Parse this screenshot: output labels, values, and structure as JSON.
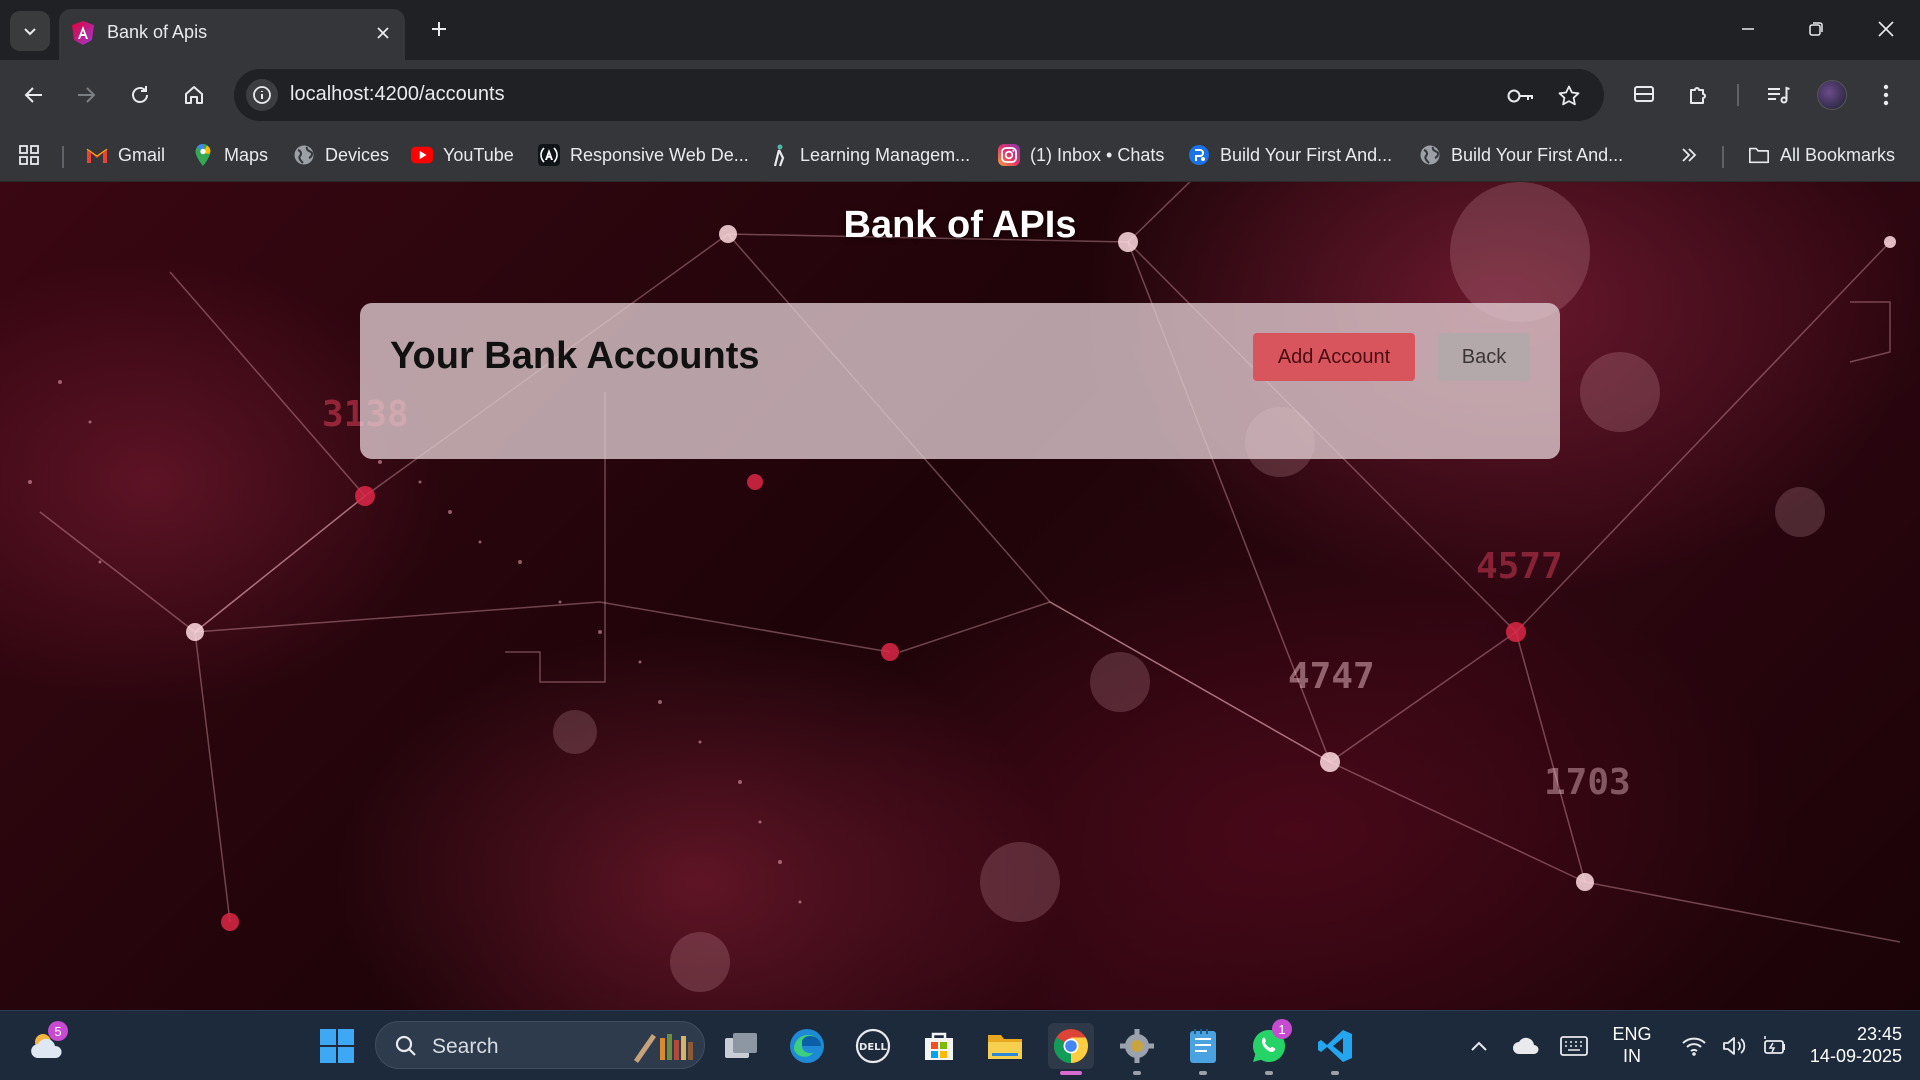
{
  "browser": {
    "tab_title": "Bank of Apis",
    "url": "localhost:4200/accounts",
    "bookmarks": [
      {
        "label": "Gmail",
        "icon": "gmail-icon"
      },
      {
        "label": "Maps",
        "icon": "maps-icon"
      },
      {
        "label": "Devices",
        "icon": "globe-icon"
      },
      {
        "label": "YouTube",
        "icon": "youtube-icon"
      },
      {
        "label": "Responsive Web De...",
        "icon": "angular-icon"
      },
      {
        "label": "Learning Managem...",
        "icon": "lms-icon"
      },
      {
        "label": "(1) Inbox • Chats",
        "icon": "instagram-icon"
      },
      {
        "label": "Build Your First And...",
        "icon": "blue-globe-icon"
      },
      {
        "label": "Build Your First And...",
        "icon": "globe-icon"
      }
    ],
    "all_bookmarks_label": "All Bookmarks"
  },
  "page": {
    "title": "Bank of APIs",
    "card_heading": "Your Bank Accounts",
    "add_account_label": "Add Account",
    "back_label": "Back",
    "background_numbers": [
      "3138",
      "4747",
      "4577",
      "1703"
    ]
  },
  "taskbar": {
    "weather_badge": "5",
    "search_placeholder": "Search",
    "whatsapp_badge": "1",
    "language_line1": "ENG",
    "language_line2": "IN",
    "time": "23:45",
    "date": "14-09-2025"
  },
  "colors": {
    "add_button": "#d9555e",
    "back_button": "#b3a8aa",
    "card_background": "#e1cdd2",
    "page_accent": "#8e1a30"
  }
}
